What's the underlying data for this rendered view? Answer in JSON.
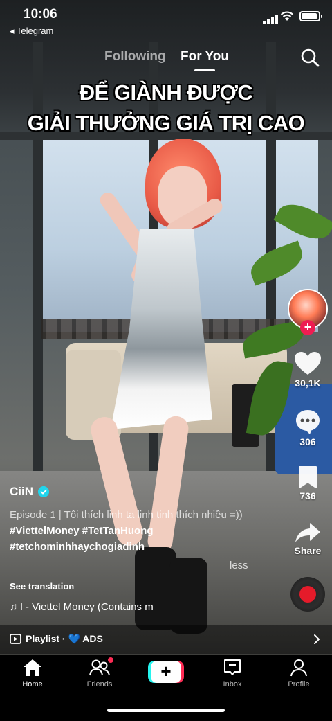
{
  "status_bar": {
    "time": "10:06",
    "back_app": "◂ Telegram"
  },
  "feed_tabs": [
    {
      "label": "Following",
      "active": false
    },
    {
      "label": "For You",
      "active": true
    }
  ],
  "overlay_caption": {
    "line1": "ĐỂ GIÀNH ĐƯỢC",
    "line2": "GIẢI THƯỞNG GIÁ TRỊ CAO"
  },
  "actions": {
    "likes": "30,1K",
    "comments": "306",
    "bookmarks": "736",
    "share_label": "Share"
  },
  "post": {
    "username": "CiiN",
    "verified": true,
    "description_plain": "Episode 1 | Tôi thích linh ta linh tinh thích nhiều =)) ",
    "hashtags_line1": "#ViettelMoney #TetTanHuong",
    "hashtags_line2": "#tetchominhhaychogiadinh",
    "less_label": "less",
    "see_translation": "See translation",
    "music": "♫ l - Viettel Money (Contains m"
  },
  "playlist": {
    "label": "Playlist · 💙 ADS"
  },
  "bottom_nav": [
    {
      "label": "Home",
      "active": true
    },
    {
      "label": "Friends",
      "active": false
    },
    {
      "label": "+",
      "active": false
    },
    {
      "label": "Inbox",
      "active": false
    },
    {
      "label": "Profile",
      "active": false
    }
  ],
  "colors": {
    "accent_red": "#fe2c55",
    "accent_cyan": "#25f4ee",
    "verified": "#20d5ec"
  }
}
